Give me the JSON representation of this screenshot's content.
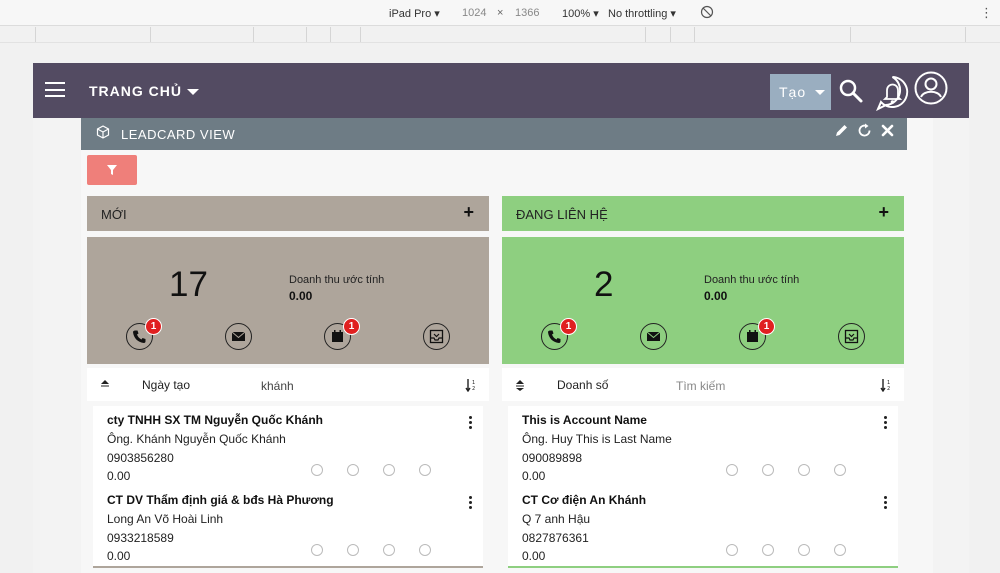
{
  "devtools": {
    "device": "iPad Pro ▾",
    "width": "1024",
    "times": "×",
    "height": "1366",
    "zoom": "100% ▾",
    "throttling": "No throttling ▾"
  },
  "navbar": {
    "home_label": "TRANG CHỦ",
    "create_label": "Tạo"
  },
  "leadcard": {
    "title": "LEADCARD VIEW"
  },
  "columns": [
    {
      "name": "MỚI",
      "count": "17",
      "revenue_label": "Doanh thu ước tính",
      "revenue_value": "0.00",
      "badges": {
        "call": "1",
        "meeting": "1"
      },
      "sort_label": "Ngày tạo",
      "search_value": "khánh",
      "search_placeholder": "",
      "color": "#aea59b",
      "cards": [
        {
          "name": "cty TNHH SX TM Nguyễn Quốc Khánh",
          "contact": "Ông. Khánh Nguyễn Quốc Khánh",
          "phone": "0903856280",
          "amount": "0.00"
        },
        {
          "name": "CT DV Thẩm định giá & bđs Hà Phương",
          "contact": "Long An Võ Hoài Linh",
          "phone": "0933218589",
          "amount": "0.00"
        }
      ]
    },
    {
      "name": "ĐANG LIÊN HỆ",
      "count": "2",
      "revenue_label": "Doanh thu ước tính",
      "revenue_value": "0.00",
      "badges": {
        "call": "1",
        "meeting": "1"
      },
      "sort_label": "Doanh số",
      "search_value": "",
      "search_placeholder": "Tìm kiếm",
      "color": "#8ecf80",
      "cards": [
        {
          "name": "This is Account Name",
          "contact": "Ông. Huy This is Last Name",
          "phone": "090089898",
          "amount": "0.00"
        },
        {
          "name": "CT Cơ điện An Khánh",
          "contact": "Q 7 anh Hậu",
          "phone": "0827876361",
          "amount": "0.00"
        }
      ]
    }
  ],
  "icons": {
    "nav": [
      "hamburger-icon",
      "search-icon",
      "bell-icon",
      "user-icon"
    ],
    "header": [
      "cube-icon",
      "pencil-icon",
      "refresh-icon",
      "close-icon"
    ],
    "stat": [
      "phone-icon",
      "mail-icon",
      "calendar-icon",
      "inbox-icon"
    ]
  },
  "colors": {
    "navbar": "#534b62",
    "header": "#6e7c85",
    "filter": "#ef7f7a",
    "create": "#9aaec0",
    "badge": "#e02020"
  }
}
